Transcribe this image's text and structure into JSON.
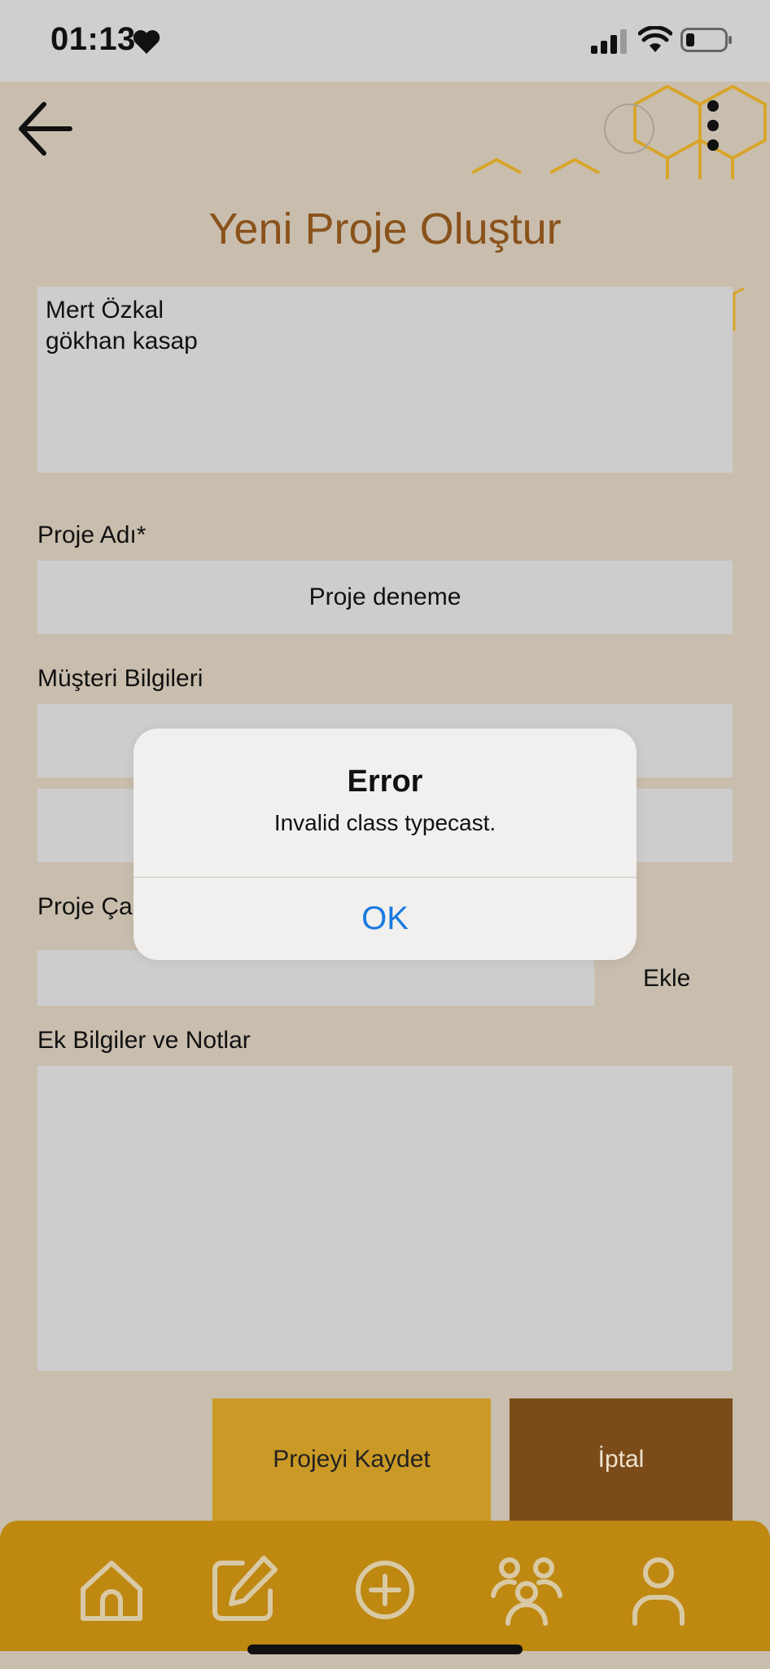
{
  "status_bar": {
    "time": "01:13",
    "heart_icon": "heart-icon",
    "signal_icon": "signal-icon",
    "wifi_icon": "wifi-icon",
    "battery_icon": "battery-icon"
  },
  "header": {
    "title": "Yeni Proje Oluştur",
    "back_icon": "arrow-left-icon",
    "menu_icon": "more-vertical-icon"
  },
  "form": {
    "participants": [
      "Mert Özkal",
      "gökhan kasap"
    ],
    "project_name_label": "Proje Adı*",
    "project_name_value": "Proje deneme",
    "customer_label": "Müşteri Bilgileri",
    "customer_field_1_value": "",
    "customer_field_2_value": "",
    "employees_label": "Proje Ça",
    "employee_input_value": "",
    "add_button": "Ekle",
    "notes_label": "Ek Bilgiler ve Notlar",
    "notes_value": "",
    "save_button": "Projeyi Kaydet",
    "cancel_button": "İptal"
  },
  "bottom_nav": {
    "items": [
      "home-icon",
      "edit-icon",
      "add-circle-icon",
      "team-icon",
      "user-icon"
    ]
  },
  "alert": {
    "title": "Error",
    "message": "Invalid class typecast.",
    "ok_button": "OK"
  },
  "colors": {
    "background": "#c9beae",
    "title": "#8a521b",
    "save": "#cb9a26",
    "cancel": "#7b4b19",
    "nav": "#be8811",
    "link": "#1a7ae0"
  }
}
